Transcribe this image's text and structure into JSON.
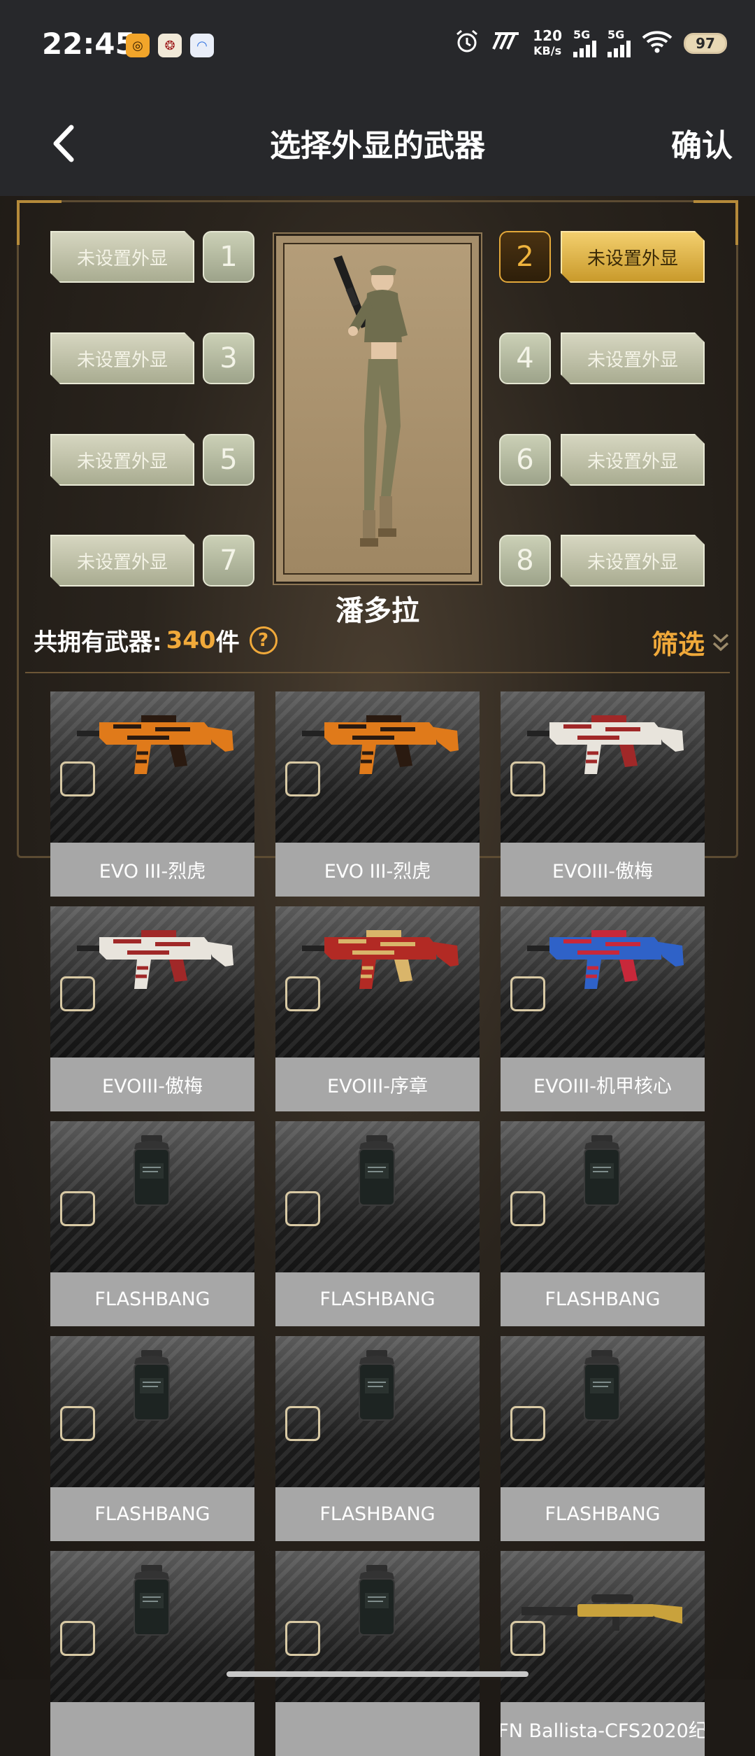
{
  "status_bar": {
    "time": "22:45",
    "net_speed_value": "120",
    "net_speed_unit": "KB/s",
    "signal1_label": "5G",
    "signal2_label": "5G",
    "battery": "97",
    "icons": [
      "alarm-icon",
      "nfc-icon",
      "signal-icon",
      "wifi-icon",
      "battery-icon"
    ]
  },
  "nav": {
    "title": "选择外显的武器",
    "confirm": "确认"
  },
  "slots": [
    {
      "num": "1",
      "label": "未设置外显"
    },
    {
      "num": "2",
      "label": "未设置外显",
      "active": true
    },
    {
      "num": "3",
      "label": "未设置外显"
    },
    {
      "num": "4",
      "label": "未设置外显"
    },
    {
      "num": "5",
      "label": "未设置外显"
    },
    {
      "num": "6",
      "label": "未设置外显"
    },
    {
      "num": "7",
      "label": "未设置外显"
    },
    {
      "num": "8",
      "label": "未设置外显"
    }
  ],
  "character": {
    "name": "潘多拉"
  },
  "inventory": {
    "count_label": "共拥有武器:",
    "count_value": "340",
    "count_unit": "件",
    "help": "?",
    "filter_label": "筛选"
  },
  "weapons": [
    {
      "name": "EVO III-烈虎",
      "kind": "smg",
      "colors": [
        "#e07a1a",
        "#2a1a10"
      ]
    },
    {
      "name": "EVO III-烈虎",
      "kind": "smg",
      "colors": [
        "#e07a1a",
        "#2a1a10"
      ]
    },
    {
      "name": "EVOIII-傲梅",
      "kind": "smg",
      "colors": [
        "#e8e4dc",
        "#a02828"
      ]
    },
    {
      "name": "EVOIII-傲梅",
      "kind": "smg",
      "colors": [
        "#e8e4dc",
        "#a02828"
      ]
    },
    {
      "name": "EVOIII-序章",
      "kind": "smg",
      "colors": [
        "#b22a24",
        "#d9b56a"
      ]
    },
    {
      "name": "EVOIII-机甲核心",
      "kind": "smg",
      "colors": [
        "#2f62c8",
        "#c8283a"
      ]
    },
    {
      "name": "FLASHBANG",
      "kind": "grenade"
    },
    {
      "name": "FLASHBANG",
      "kind": "grenade"
    },
    {
      "name": "FLASHBANG",
      "kind": "grenade"
    },
    {
      "name": "FLASHBANG",
      "kind": "grenade"
    },
    {
      "name": "FLASHBANG",
      "kind": "grenade"
    },
    {
      "name": "FLASHBANG",
      "kind": "grenade"
    },
    {
      "name": "",
      "kind": "grenade"
    },
    {
      "name": "",
      "kind": "grenade"
    },
    {
      "name": "FN Ballista-CFS2020纪",
      "kind": "sniper",
      "colors": [
        "#2b2b2b",
        "#c9a23c"
      ]
    }
  ]
}
